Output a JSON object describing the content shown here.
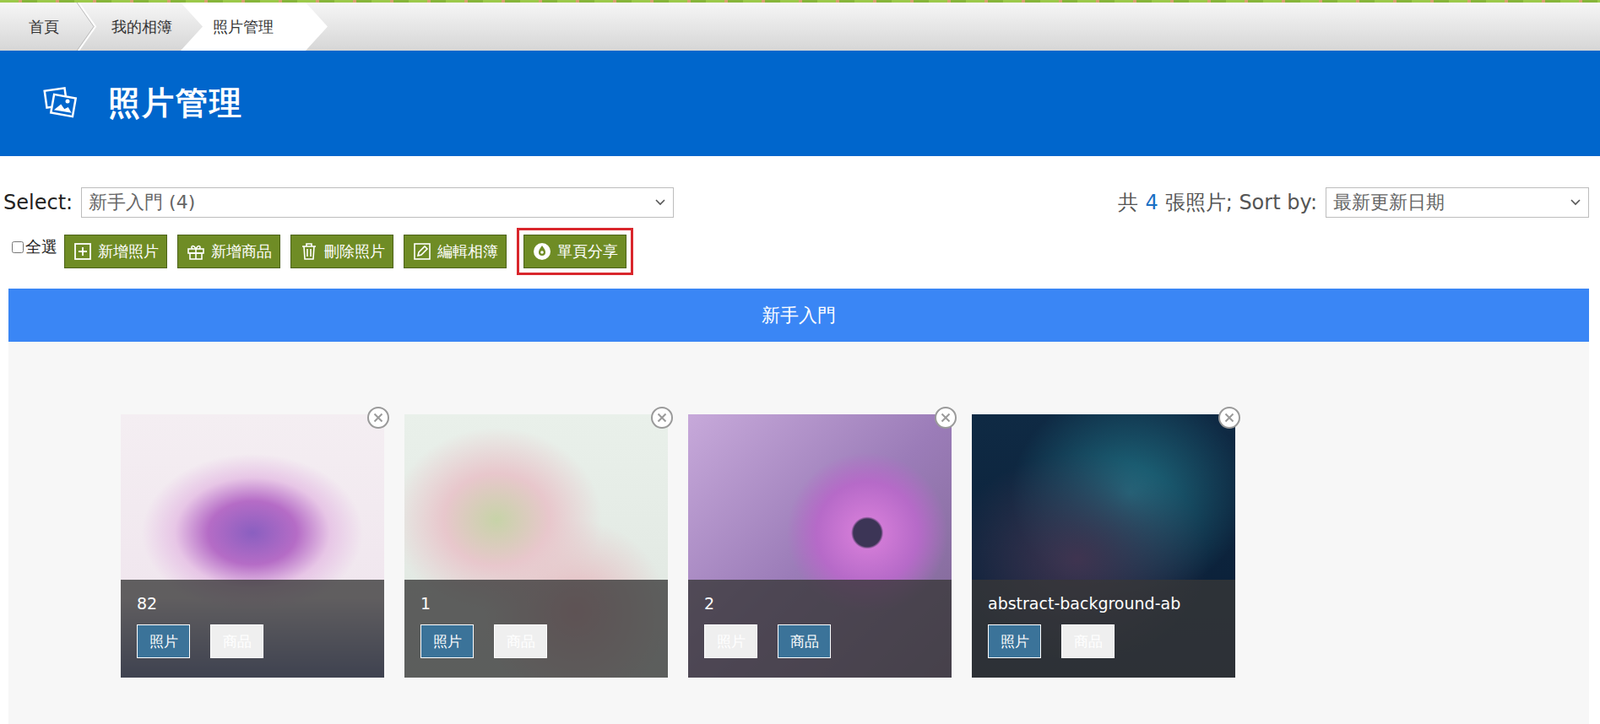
{
  "breadcrumb": [
    {
      "label": "首頁",
      "selected": false
    },
    {
      "label": "我的相簿",
      "selected": false
    },
    {
      "label": "照片管理",
      "selected": true
    }
  ],
  "header": {
    "title": "照片管理"
  },
  "album_select": {
    "label": "Select:",
    "value": "新手入門 (4)"
  },
  "summary": {
    "prefix": "共",
    "count": "4",
    "suffix": "張照片; Sort by:"
  },
  "sort_select": {
    "value": "最新更新日期"
  },
  "select_all": {
    "label": "全選",
    "checked": false
  },
  "buttons": [
    {
      "label": "新增照片",
      "kind": "add",
      "highlighted": false
    },
    {
      "label": "新增商品",
      "kind": "gift",
      "highlighted": false
    },
    {
      "label": "刪除照片",
      "kind": "trash",
      "highlighted": false
    },
    {
      "label": "編輯相簿",
      "kind": "edit",
      "highlighted": false
    },
    {
      "label": "單頁分享",
      "kind": "share",
      "highlighted": true
    }
  ],
  "album": {
    "title": "新手入門"
  },
  "photos": [
    {
      "name": "82",
      "tags": [
        {
          "label": "照片",
          "selected": true
        },
        {
          "label": "商品",
          "selected": false
        }
      ]
    },
    {
      "name": "1",
      "tags": [
        {
          "label": "照片",
          "selected": true
        },
        {
          "label": "商品",
          "selected": false
        }
      ]
    },
    {
      "name": "2",
      "tags": [
        {
          "label": "照片",
          "selected": false
        },
        {
          "label": "商品",
          "selected": true
        }
      ]
    },
    {
      "name": "abstract-background-ab",
      "tags": [
        {
          "label": "照片",
          "selected": true
        },
        {
          "label": "商品",
          "selected": false
        }
      ]
    }
  ]
}
